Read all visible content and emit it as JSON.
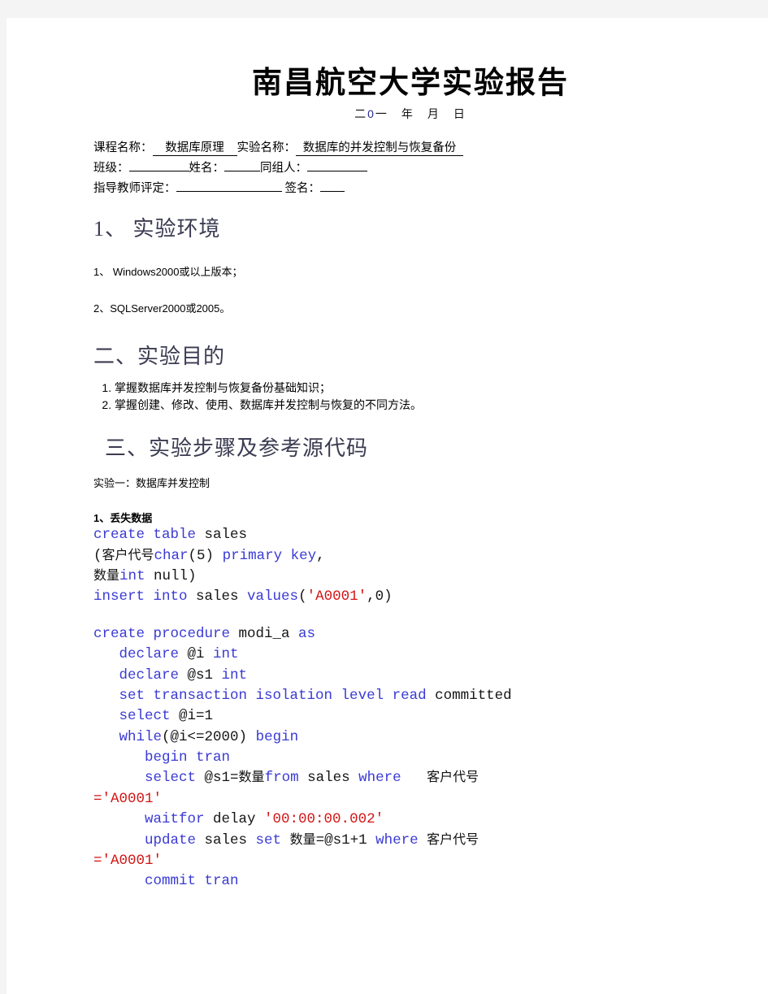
{
  "document": {
    "title": "南昌航空大学实验报告",
    "date_line": {
      "prefix": "二",
      "zero": "0",
      "suffix": "一　年　月　日"
    },
    "info": {
      "course_label": "课程名称：",
      "course_value": "数据库原理",
      "experiment_label": "实验名称：",
      "experiment_value": "数据库的并发控制与恢复备份",
      "class_label": "班级：",
      "class_value": "",
      "name_label": "姓名：",
      "name_value": "",
      "group_label": "同组人：",
      "group_value": "",
      "evaluation_label": "指导教师评定：",
      "evaluation_value": "",
      "signature_label": "签名：",
      "signature_value": ""
    },
    "sections": {
      "environment_heading": "1、 实验环境",
      "environment_items": [
        "1、 Windows2000或以上版本；",
        "2、SQLServer2000或2005。"
      ],
      "purpose_heading": "二、实验目的",
      "purpose_items": [
        "掌握数据库并发控制与恢复备份基础知识；",
        "掌握创建、修改、使用、数据库并发控制与恢复的不同方法。"
      ],
      "steps_heading": "三、实验步骤及参考源代码",
      "experiment_one": "实验一：数据库并发控制",
      "lost_update_label": "1、丢失数据"
    },
    "code": {
      "block1": [
        [
          {
            "t": "create table ",
            "c": "kw"
          },
          {
            "t": "sales",
            "c": "id"
          }
        ],
        [
          {
            "t": "(",
            "c": "id"
          },
          {
            "t": "客户代号",
            "c": "cn"
          },
          {
            "t": "char",
            "c": "kw"
          },
          {
            "t": "(5) ",
            "c": "id"
          },
          {
            "t": "primary key",
            "c": "kw"
          },
          {
            "t": ",",
            "c": "id"
          }
        ],
        [
          {
            "t": "数量",
            "c": "cn"
          },
          {
            "t": "int ",
            "c": "kw"
          },
          {
            "t": "null",
            "c": "id"
          },
          {
            "t": ")",
            "c": "id"
          }
        ],
        [
          {
            "t": "insert into ",
            "c": "kw"
          },
          {
            "t": "sales ",
            "c": "id"
          },
          {
            "t": "values",
            "c": "kw"
          },
          {
            "t": "(",
            "c": "id"
          },
          {
            "t": "'A0001'",
            "c": "str"
          },
          {
            "t": ",0)",
            "c": "id"
          }
        ]
      ],
      "block2": [
        [
          {
            "t": "create procedure ",
            "c": "kw"
          },
          {
            "t": "modi_a ",
            "c": "id"
          },
          {
            "t": "as",
            "c": "kw"
          }
        ],
        [
          {
            "t": "   ",
            "c": "id"
          },
          {
            "t": "declare ",
            "c": "kw"
          },
          {
            "t": "@i ",
            "c": "id"
          },
          {
            "t": "int",
            "c": "kw"
          }
        ],
        [
          {
            "t": "   ",
            "c": "id"
          },
          {
            "t": "declare ",
            "c": "kw"
          },
          {
            "t": "@s1 ",
            "c": "id"
          },
          {
            "t": "int",
            "c": "kw"
          }
        ],
        [
          {
            "t": "   ",
            "c": "id"
          },
          {
            "t": "set transaction isolation level read ",
            "c": "kw"
          },
          {
            "t": "committed",
            "c": "id"
          }
        ],
        [
          {
            "t": "   ",
            "c": "id"
          },
          {
            "t": "select ",
            "c": "kw"
          },
          {
            "t": "@i=1",
            "c": "id"
          }
        ],
        [
          {
            "t": "   ",
            "c": "id"
          },
          {
            "t": "while",
            "c": "kw"
          },
          {
            "t": "(@i<=2000) ",
            "c": "id"
          },
          {
            "t": "begin",
            "c": "kw"
          }
        ],
        [
          {
            "t": "      ",
            "c": "id"
          },
          {
            "t": "begin tran",
            "c": "kw"
          }
        ],
        [
          {
            "t": "      ",
            "c": "id"
          },
          {
            "t": "select ",
            "c": "kw"
          },
          {
            "t": "@s1=",
            "c": "id"
          },
          {
            "t": "数量",
            "c": "cn"
          },
          {
            "t": "from ",
            "c": "kw"
          },
          {
            "t": "sales ",
            "c": "id"
          },
          {
            "t": "where ",
            "c": "kw"
          },
          {
            "t": "  ",
            "c": "id"
          },
          {
            "t": "客户代号",
            "c": "cn"
          },
          {
            "t": "\n='A0001'",
            "c": "str"
          }
        ],
        [
          {
            "t": "      ",
            "c": "id"
          },
          {
            "t": "waitfor ",
            "c": "kw"
          },
          {
            "t": "delay ",
            "c": "id"
          },
          {
            "t": "'00:00:00.002'",
            "c": "str"
          }
        ],
        [
          {
            "t": "      ",
            "c": "id"
          },
          {
            "t": "update ",
            "c": "kw"
          },
          {
            "t": "sales ",
            "c": "id"
          },
          {
            "t": "set ",
            "c": "kw"
          },
          {
            "t": "数量",
            "c": "cn"
          },
          {
            "t": "=@s1+1 ",
            "c": "id"
          },
          {
            "t": "where ",
            "c": "kw"
          },
          {
            "t": "客户代号",
            "c": "cn"
          },
          {
            "t": "\n='A0001'",
            "c": "str"
          }
        ],
        [
          {
            "t": "      ",
            "c": "id"
          },
          {
            "t": "commit tran",
            "c": "kw"
          }
        ]
      ]
    }
  }
}
